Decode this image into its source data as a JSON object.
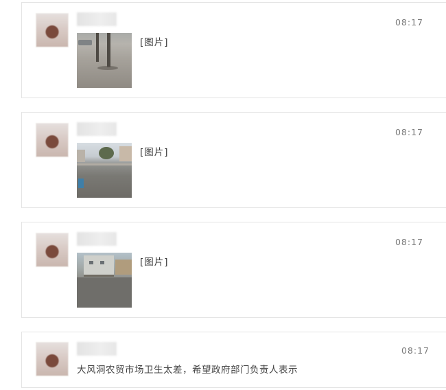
{
  "feed": {
    "items": [
      {
        "username": "",
        "time": "08:17",
        "tag": "[图片]",
        "photo_icon": "street-trees-photo"
      },
      {
        "username": "",
        "time": "08:17",
        "tag": "[图片]",
        "photo_icon": "street-hill-photo"
      },
      {
        "username": "",
        "time": "08:17",
        "tag": "[图片]",
        "photo_icon": "street-buildings-photo"
      },
      {
        "username": "",
        "time": "08:17",
        "text": "大风洞农贸市场卫生太差，希望政府部门负责人表示"
      }
    ]
  }
}
